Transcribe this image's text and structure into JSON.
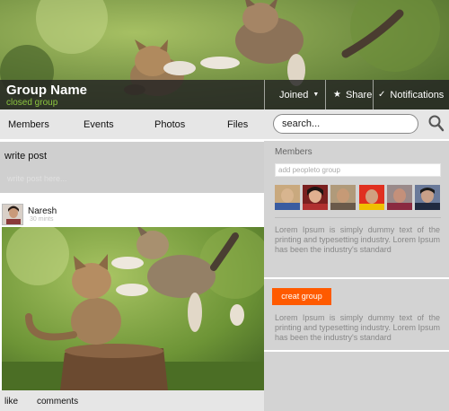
{
  "cover": {
    "group_name": "Group Name",
    "group_type": "closed group",
    "joined_label": "Joined",
    "share_label": "Share",
    "notifications_label": "Notifications"
  },
  "tabs": [
    "Members",
    "Events",
    "Photos",
    "Files"
  ],
  "search": {
    "value": "search..."
  },
  "feed": {
    "write_label": "write post",
    "write_placeholder": "write post here...",
    "post": {
      "author": "Naresh",
      "time": "30 mints",
      "like_label": "like",
      "comments_label": "comments"
    }
  },
  "sidebar": {
    "members_title": "Members",
    "add_placeholder": "add peopleto group",
    "members_text": "Lorem Ipsum is simply dummy text of the printing and typesetting industry. Lorem Ipsum has been the industry's standard",
    "create_label": "creat group",
    "create_text": "Lorem Ipsum is simply dummy text of the printing and typesetting industry. Lorem Ipsum has been the industry's standard"
  },
  "colors": {
    "accent": "#ff5a00",
    "closed_group": "#8cc63f",
    "bar": "#232323"
  },
  "icons": [
    "star-icon",
    "check-icon",
    "caret-down-icon",
    "search-icon"
  ]
}
